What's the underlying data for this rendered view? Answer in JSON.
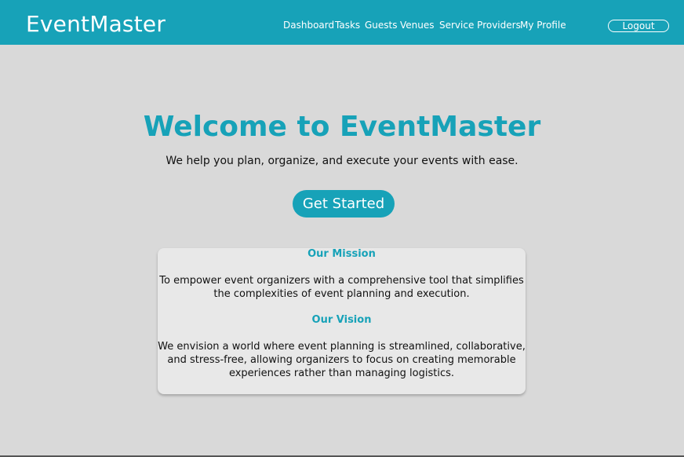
{
  "header": {
    "brand": "EventMaster",
    "nav": [
      {
        "label": "Dashboard"
      },
      {
        "label": "Tasks"
      },
      {
        "label": "Guests"
      },
      {
        "label": "Venues"
      },
      {
        "label": "Service Providers"
      },
      {
        "label": "My Profile"
      }
    ],
    "logout_label": "Logout"
  },
  "hero": {
    "title": "Welcome to EventMaster",
    "subtitle": "We help you plan, organize, and execute your events with ease.",
    "cta_label": "Get Started"
  },
  "info_card": {
    "mission_heading": "Our Mission",
    "mission_lines": [
      "To empower event organizers with a comprehensive tool that simplifies",
      "the complexities of event planning and execution."
    ],
    "vision_heading": "Our Vision",
    "vision_lines": [
      "We envision a world where event planning is streamlined, collaborative,",
      "and stress-free, allowing organizers to focus on creating memorable",
      "experiences rather than managing logistics."
    ]
  },
  "colors": {
    "accent": "#17a2b8",
    "page_background": "#d9d9d9",
    "card_background": "#e8e8e8"
  }
}
